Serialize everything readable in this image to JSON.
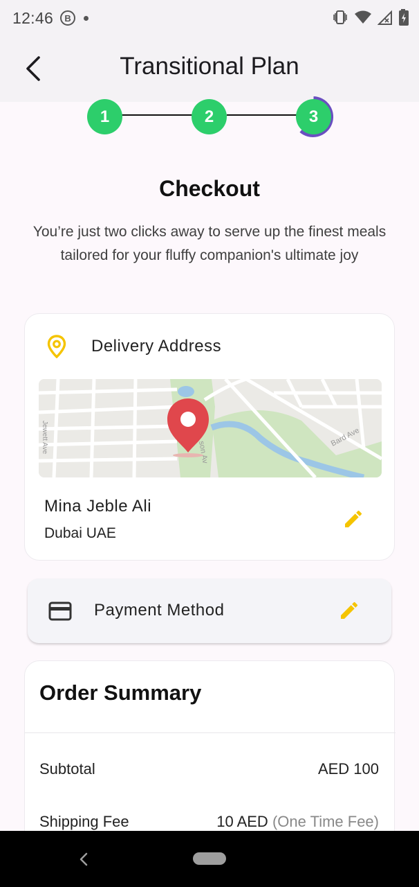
{
  "status_bar": {
    "time": "12:46",
    "b_badge": "B"
  },
  "app_bar": {
    "title": "Transitional Plan"
  },
  "stepper": {
    "steps": [
      "1",
      "2",
      "3"
    ],
    "current_step": 3
  },
  "checkout": {
    "title": "Checkout",
    "description": "You’re just two clicks away to serve up the finest meals tailored for your fluffy companion's ultimate joy"
  },
  "delivery": {
    "label": "Delivery Address",
    "map_labels": {
      "street_1": "Jewett Ave",
      "street_2": "Bard Ave",
      "street_3": "son Av"
    },
    "name": "Mina Jeble Ali",
    "city": "Dubai UAE"
  },
  "payment": {
    "label": "Payment Method"
  },
  "summary": {
    "title": "Order Summary",
    "rows": [
      {
        "label": "Subtotal",
        "value": "AED 100",
        "note": ""
      },
      {
        "label": "Shipping Fee",
        "value": "10 AED",
        "note": "(One Time Fee)"
      }
    ]
  },
  "colors": {
    "accent_yellow": "#f5c400",
    "step_green": "#2dce6b",
    "step_ring_purple": "#6a4fc0",
    "map_pin_red": "#e0474c"
  }
}
